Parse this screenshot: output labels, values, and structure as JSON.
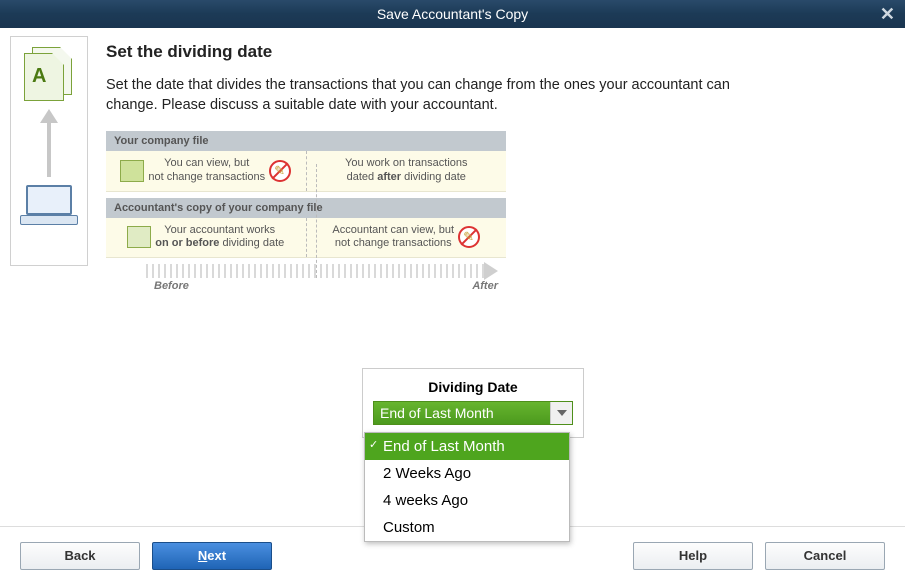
{
  "title": "Save Accountant's Copy",
  "heading": "Set the dividing date",
  "description": "Set the date that divides the transactions that you can change from the ones your accountant can change. Please discuss a suitable date with your accountant.",
  "diagram": {
    "company_header": "Your company file",
    "company_left": "You can view, but\nnot change transactions",
    "company_right_a": "You work on transactions",
    "company_right_b": "dated ",
    "company_right_bold": "after",
    "company_right_c": " dividing date",
    "acct_header": "Accountant's copy of your company file",
    "acct_left_a": "Your accountant works",
    "acct_left_bold": "on or before",
    "acct_left_b": " dividing date",
    "acct_right": "Accountant can view, but\nnot change transactions",
    "before": "Before",
    "after": "After"
  },
  "dividing": {
    "label": "Dividing Date",
    "selected": "End of Last Month",
    "options": [
      "End of Last Month",
      "2 Weeks Ago",
      "4 weeks Ago",
      "Custom"
    ]
  },
  "buttons": {
    "back": "Back",
    "next_prefix": "N",
    "next_rest": "ext",
    "help": "Help",
    "cancel": "Cancel"
  }
}
